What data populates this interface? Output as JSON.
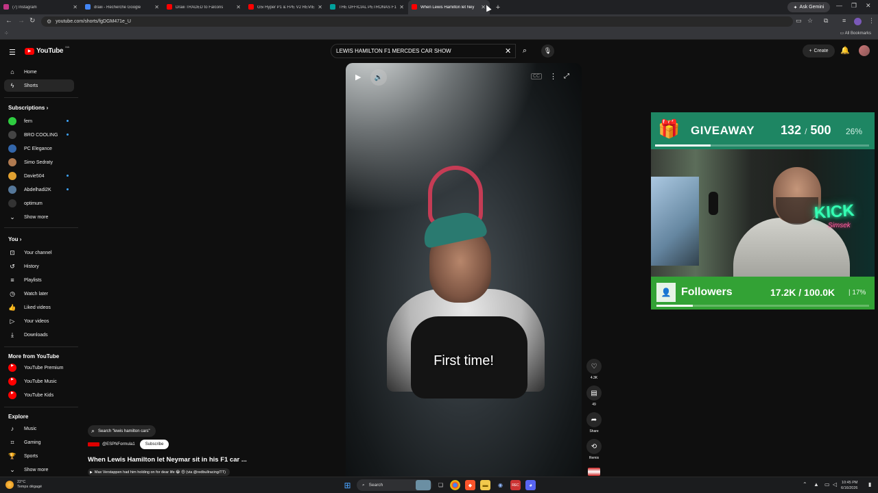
{
  "browser": {
    "tabs": [
      {
        "title": "(7) Instagram",
        "color": "#c13584"
      },
      {
        "title": "draiii - Recherche Google",
        "color": "#4285f4"
      },
      {
        "title": "Draiii TRADED to Falcons",
        "color": "#ff0000"
      },
      {
        "title": "G5i Hyper P1 & FPE V2 REVIEW",
        "color": "#ff0000"
      },
      {
        "title": "THE OFFICIAL PETRONAS F1 TEAM",
        "color": "#00a19c"
      },
      {
        "title": "When Lewis Hamilton let Ney",
        "color": "#ff0000",
        "active": true
      }
    ],
    "new_tab": "+",
    "ask_gemini": "Ask Gemini",
    "url": "youtube.com/shorts/fgDGM471e_U",
    "all_bookmarks": "All Bookmarks"
  },
  "youtube": {
    "logo_text": "YouTube",
    "logo_country": "MA",
    "search_query": "LEWIS HAMILTON F1 MERCDES CAR SHOW",
    "create_label": "Create"
  },
  "sidebar": {
    "main": [
      {
        "label": "Home",
        "icon": "home-icon"
      },
      {
        "label": "Shorts",
        "icon": "shorts-icon",
        "active": true
      }
    ],
    "subscriptions_header": "Subscriptions",
    "subscriptions": [
      {
        "label": "fern",
        "color": "#2ecc40",
        "dot": true
      },
      {
        "label": "BRO COOLING",
        "color": "#444",
        "dot": true
      },
      {
        "label": "PC Elegance",
        "color": "#3366aa",
        "dot": false
      },
      {
        "label": "Simo Sedraty",
        "color": "#b07a50",
        "dot": false
      },
      {
        "label": "Davie504",
        "color": "#e0a030",
        "dot": true
      },
      {
        "label": "Abdelhadi2K",
        "color": "#557799",
        "dot": true
      },
      {
        "label": "optimum",
        "color": "#333",
        "dot": false
      }
    ],
    "show_more": "Show more",
    "you_header": "You",
    "you_items": [
      {
        "label": "Your channel",
        "icon": "user-icon"
      },
      {
        "label": "History",
        "icon": "history-icon"
      },
      {
        "label": "Playlists",
        "icon": "playlist-icon"
      },
      {
        "label": "Watch later",
        "icon": "clock-icon"
      },
      {
        "label": "Liked videos",
        "icon": "thumbs-up-icon"
      },
      {
        "label": "Your videos",
        "icon": "video-icon"
      },
      {
        "label": "Downloads",
        "icon": "download-icon"
      }
    ],
    "more_header": "More from YouTube",
    "more_items": [
      {
        "label": "YouTube Premium"
      },
      {
        "label": "YouTube Music"
      },
      {
        "label": "YouTube Kids"
      }
    ],
    "explore_header": "Explore",
    "explore_items": [
      {
        "label": "Music",
        "icon": "music-note-icon"
      },
      {
        "label": "Gaming",
        "icon": "gamepad-icon"
      },
      {
        "label": "Sports",
        "icon": "trophy-icon"
      }
    ],
    "explore_show_more": "Show more"
  },
  "short": {
    "caption": "First time!",
    "search_suggestion": "Search \"lewis hamilton cars\"",
    "channel": "@ESPNFormula1",
    "subscribe_label": "Subscribe",
    "title": "When Lewis Hamilton let Neymar sit in his F1 car ...",
    "music": "Max Verstappen had him holding on for dear life 😂 😍 (via @redbullracing/TT)",
    "actions": {
      "likes": "4.3K",
      "comments": "49",
      "share": "Share",
      "remix": "Remix"
    }
  },
  "overlay": {
    "giveaway_label": "GIVEAWAY",
    "giveaway_current": "132",
    "giveaway_sep": "/",
    "giveaway_goal": "500",
    "giveaway_pct": "26%",
    "giveaway_fraction": 0.26,
    "neon_sign": "KICK",
    "neon_sub": "Simsek",
    "followers_label": "Followers",
    "followers_count": "17.2K / 100.0K",
    "followers_pct": "| 17%",
    "followers_fraction": 0.17
  },
  "taskbar": {
    "temperature": "22°C",
    "weather": "Temps dégagé",
    "search_label": "Search",
    "time": "10:45 PM",
    "date": "6/16/2026"
  }
}
